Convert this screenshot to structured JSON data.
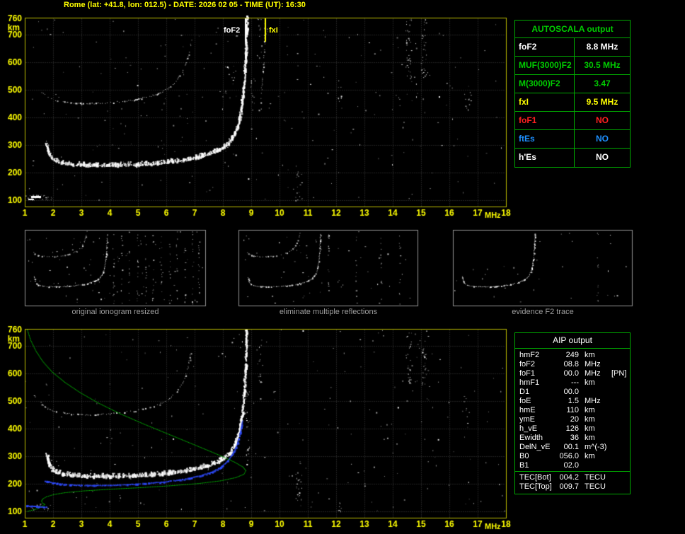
{
  "header": {
    "title": "Rome (lat: +41.8, lon: 012.5) - DATE: 2026 02 05 - TIME (UT): 16:30"
  },
  "colors": {
    "background": "#000000",
    "axis": "#ffff00",
    "plot_border": "#b9b900",
    "table_border": "#00aa00",
    "profile_green": "#00c000",
    "fit_blue": "#2e4bff",
    "trace_white": "#ffffff"
  },
  "autoscala_table": {
    "title": "AUTOSCALA output",
    "rows": [
      {
        "param": "foF2",
        "value": "8.8 MHz",
        "color": "#ffffff"
      },
      {
        "param": "MUF(3000)F2",
        "value": "30.5 MHz",
        "color": "#00cc00"
      },
      {
        "param": "M(3000)F2",
        "value": "3.47",
        "color": "#00cc00"
      },
      {
        "param": "fxI",
        "value": "9.5 MHz",
        "color": "#ffff00"
      },
      {
        "param": "foF1",
        "value": "NO",
        "color": "#ff2020"
      },
      {
        "param": "ftEs",
        "value": "NO",
        "color": "#1e90ff"
      },
      {
        "param": "h'Es",
        "value": "NO",
        "color": "#ffffff"
      }
    ]
  },
  "thumbnails": [
    {
      "caption": "original ionogram resized"
    },
    {
      "caption": "eliminate multiple reflections"
    },
    {
      "caption": "evidence F2 trace"
    }
  ],
  "aip_table": {
    "title": "AIP output",
    "rows": [
      {
        "param": "hmF2",
        "value": "249",
        "unit": "km",
        "extra": ""
      },
      {
        "param": "foF2",
        "value": "08.8",
        "unit": "MHz",
        "extra": ""
      },
      {
        "param": "foF1",
        "value": "00.0",
        "unit": "MHz",
        "extra": "[PN]"
      },
      {
        "param": "hmF1",
        "value": "---",
        "unit": "km",
        "extra": ""
      },
      {
        "param": "D1",
        "value": "00.0",
        "unit": "",
        "extra": ""
      },
      {
        "param": "foE",
        "value": "1.5",
        "unit": "MHz",
        "extra": ""
      },
      {
        "param": "hmE",
        "value": "110",
        "unit": "km",
        "extra": ""
      },
      {
        "param": "ymE",
        "value": "20",
        "unit": "km",
        "extra": ""
      },
      {
        "param": "h_vE",
        "value": "126",
        "unit": "km",
        "extra": ""
      },
      {
        "param": "Ewidth",
        "value": "36",
        "unit": "km",
        "extra": ""
      },
      {
        "param": "DelN_vE",
        "value": "00.1",
        "unit": "m^(-3)",
        "extra": ""
      },
      {
        "param": "B0",
        "value": "056.0",
        "unit": "km",
        "extra": ""
      },
      {
        "param": "B1",
        "value": "02.0",
        "unit": "",
        "extra": ""
      }
    ],
    "tec_rows": [
      {
        "param": "TEC[Bot]",
        "value": "004.2",
        "unit": "TECU"
      },
      {
        "param": "TEC[Top]",
        "value": "009.7",
        "unit": "TECU"
      }
    ]
  },
  "chart_data": [
    {
      "type": "scatter",
      "xlabel": "MHz",
      "ylabel": "km",
      "xlim": [
        1,
        18
      ],
      "ylim": [
        100,
        760
      ],
      "grid": true,
      "x_ticks": [
        1,
        2,
        3,
        4,
        5,
        6,
        7,
        8,
        9,
        10,
        11,
        12,
        13,
        14,
        15,
        16,
        17,
        18
      ],
      "y_ticks": [
        760,
        700,
        600,
        500,
        400,
        300,
        200,
        100
      ],
      "markers": [
        {
          "label": "foF2",
          "x": 8.8,
          "color": "#ffffff"
        },
        {
          "label": "fxI",
          "x": 9.5,
          "color": "#ffff00"
        }
      ],
      "series": [
        {
          "name": "F2 trace",
          "role": "trace",
          "color": "#ffffff",
          "points": [
            [
              1.75,
              305
            ],
            [
              1.8,
              285
            ],
            [
              1.85,
              268
            ],
            [
              1.95,
              252
            ],
            [
              2.1,
              242
            ],
            [
              2.3,
              236
            ],
            [
              2.6,
              231
            ],
            [
              3.0,
              228
            ],
            [
              3.5,
              227
            ],
            [
              4.0,
              227
            ],
            [
              4.5,
              228
            ],
            [
              5.0,
              230
            ],
            [
              5.5,
              233
            ],
            [
              6.0,
              238
            ],
            [
              6.4,
              243
            ],
            [
              6.8,
              250
            ],
            [
              7.2,
              259
            ],
            [
              7.5,
              268
            ],
            [
              7.8,
              280
            ],
            [
              8.05,
              295
            ],
            [
              8.25,
              315
            ],
            [
              8.4,
              340
            ],
            [
              8.5,
              368
            ],
            [
              8.58,
              400
            ],
            [
              8.64,
              435
            ],
            [
              8.69,
              475
            ],
            [
              8.73,
              520
            ],
            [
              8.76,
              570
            ],
            [
              8.78,
              620
            ],
            [
              8.8,
              670
            ],
            [
              8.81,
              720
            ],
            [
              8.82,
              760
            ]
          ]
        },
        {
          "name": "multiple reflection",
          "role": "multiple",
          "color": "#e6e6e6",
          "points": [
            [
              1.6,
              490
            ],
            [
              1.8,
              474
            ],
            [
              2.1,
              463
            ],
            [
              2.5,
              456
            ],
            [
              3.0,
              452
            ],
            [
              3.5,
              452
            ],
            [
              4.0,
              455
            ],
            [
              4.5,
              460
            ],
            [
              5.0,
              468
            ],
            [
              5.4,
              478
            ],
            [
              5.8,
              492
            ],
            [
              6.1,
              510
            ],
            [
              6.35,
              535
            ],
            [
              6.55,
              565
            ],
            [
              6.7,
              600
            ],
            [
              6.8,
              640
            ],
            [
              6.87,
              680
            ]
          ]
        },
        {
          "name": "x-mode asymptote",
          "role": "asymptote",
          "color": "#d4d4d4",
          "points": [
            [
              9.28,
              430
            ],
            [
              9.33,
              470
            ],
            [
              9.37,
              515
            ],
            [
              9.41,
              565
            ],
            [
              9.44,
              620
            ],
            [
              9.46,
              680
            ],
            [
              9.48,
              740
            ],
            [
              9.49,
              760
            ]
          ]
        }
      ]
    },
    {
      "type": "scatter",
      "xlabel": "MHz",
      "ylabel": "km",
      "xlim": [
        1,
        18
      ],
      "ylim": [
        100,
        760
      ],
      "grid": true,
      "x_ticks": [
        1,
        2,
        3,
        4,
        5,
        6,
        7,
        8,
        9,
        10,
        11,
        12,
        13,
        14,
        15,
        16,
        17,
        18
      ],
      "y_ticks": [
        760,
        700,
        600,
        500,
        400,
        300,
        200,
        100
      ],
      "series": [
        {
          "name": "F2 trace",
          "role": "trace",
          "color": "#ffffff",
          "points": [
            [
              1.75,
              305
            ],
            [
              1.8,
              285
            ],
            [
              1.85,
              268
            ],
            [
              1.95,
              252
            ],
            [
              2.1,
              242
            ],
            [
              2.3,
              236
            ],
            [
              2.6,
              231
            ],
            [
              3.0,
              228
            ],
            [
              3.5,
              227
            ],
            [
              4.0,
              227
            ],
            [
              4.5,
              228
            ],
            [
              5.0,
              230
            ],
            [
              5.5,
              233
            ],
            [
              6.0,
              238
            ],
            [
              6.4,
              243
            ],
            [
              6.8,
              250
            ],
            [
              7.2,
              259
            ],
            [
              7.5,
              268
            ],
            [
              7.8,
              280
            ],
            [
              8.05,
              295
            ],
            [
              8.25,
              315
            ],
            [
              8.4,
              340
            ],
            [
              8.5,
              368
            ],
            [
              8.58,
              400
            ],
            [
              8.64,
              435
            ],
            [
              8.69,
              475
            ],
            [
              8.73,
              520
            ],
            [
              8.76,
              570
            ],
            [
              8.78,
              620
            ],
            [
              8.8,
              670
            ],
            [
              8.81,
              720
            ],
            [
              8.82,
              760
            ]
          ]
        },
        {
          "name": "multiple reflection",
          "role": "multiple",
          "color": "#dcdcdc",
          "points": [
            [
              1.6,
              490
            ],
            [
              1.8,
              474
            ],
            [
              2.1,
              463
            ],
            [
              2.5,
              456
            ],
            [
              3.0,
              452
            ],
            [
              3.5,
              452
            ],
            [
              4.0,
              455
            ],
            [
              4.5,
              460
            ],
            [
              5.0,
              468
            ],
            [
              5.4,
              478
            ],
            [
              5.8,
              492
            ],
            [
              6.1,
              510
            ],
            [
              6.35,
              535
            ],
            [
              6.55,
              565
            ],
            [
              6.7,
              600
            ],
            [
              6.8,
              640
            ],
            [
              6.87,
              680
            ]
          ]
        },
        {
          "name": "restored trace",
          "role": "fit",
          "color": "#2e4bff",
          "points": [
            [
              1.7,
              212
            ],
            [
              2.0,
              205
            ],
            [
              2.4,
              200
            ],
            [
              2.9,
              197
            ],
            [
              3.4,
              196
            ],
            [
              4.0,
              197
            ],
            [
              4.6,
              199
            ],
            [
              5.2,
              203
            ],
            [
              5.8,
              208
            ],
            [
              6.3,
              214
            ],
            [
              6.8,
              222
            ],
            [
              7.2,
              232
            ],
            [
              7.6,
              245
            ],
            [
              7.9,
              262
            ],
            [
              8.15,
              285
            ],
            [
              8.35,
              315
            ],
            [
              8.5,
              350
            ],
            [
              8.6,
              390
            ],
            [
              8.67,
              430
            ]
          ]
        },
        {
          "name": "electron density profile",
          "role": "profile",
          "color": "#00c000",
          "points": [
            [
              1.08,
              760
            ],
            [
              1.2,
              722
            ],
            [
              1.38,
              684
            ],
            [
              1.62,
              646
            ],
            [
              1.95,
              608
            ],
            [
              2.4,
              570
            ],
            [
              2.95,
              532
            ],
            [
              3.6,
              494
            ],
            [
              4.35,
              456
            ],
            [
              5.2,
              418
            ],
            [
              6.1,
              380
            ],
            [
              7.0,
              342
            ],
            [
              7.8,
              308
            ],
            [
              8.4,
              280
            ],
            [
              8.7,
              262
            ],
            [
              8.8,
              249
            ],
            [
              8.73,
              236
            ],
            [
              8.45,
              224
            ],
            [
              7.9,
              212
            ],
            [
              7.1,
              202
            ],
            [
              6.1,
              194
            ],
            [
              5.0,
              187
            ],
            [
              3.9,
              181
            ],
            [
              3.0,
              175
            ],
            [
              2.4,
              169
            ],
            [
              2.0,
              162
            ],
            [
              1.75,
              154
            ],
            [
              1.62,
              146
            ],
            [
              1.58,
              138
            ],
            [
              1.62,
              131
            ],
            [
              1.7,
              126
            ],
            [
              1.6,
              120
            ],
            [
              1.5,
              115
            ],
            [
              1.45,
              111
            ],
            [
              1.3,
              107
            ],
            [
              1.15,
              103
            ],
            [
              1.05,
              100
            ]
          ]
        },
        {
          "name": "E-valley marker",
          "role": "mark",
          "color": "#2e4bff",
          "points": [
            [
              1.05,
              122
            ],
            [
              1.2,
              121
            ],
            [
              1.35,
              120
            ],
            [
              1.5,
              119
            ],
            [
              1.65,
              118
            ],
            [
              1.75,
              117
            ]
          ]
        }
      ]
    }
  ]
}
